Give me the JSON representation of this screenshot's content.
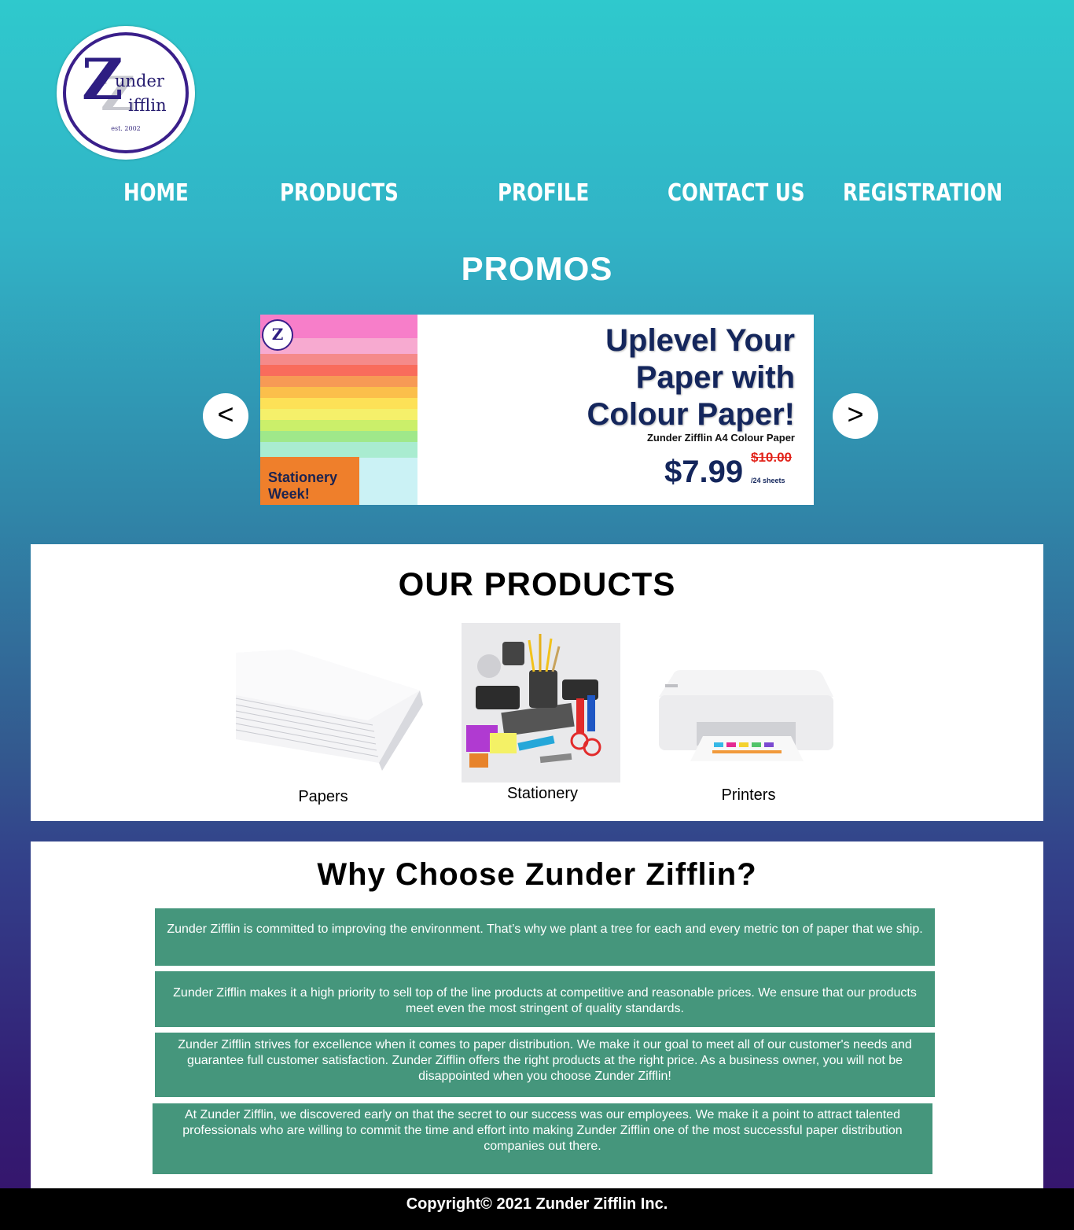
{
  "logo": {
    "initial_1": "Z",
    "initial_2": "Z",
    "word_1": "under",
    "word_2": "ifflin",
    "est": "est. 2002"
  },
  "nav": {
    "home": "Home",
    "products": "Products",
    "profile": "Profile",
    "contact": "Contact Us",
    "registration": "Registration"
  },
  "promos": {
    "title": "PROMOS",
    "prev": "<",
    "next": ">",
    "banner": {
      "tag_line1": "Stationery",
      "tag_line2": "Week!",
      "mini_logo": "Z",
      "headline_1": "Uplevel Your",
      "headline_2": "Paper with",
      "headline_3": "Colour Paper!",
      "subline": "Zunder Zifflin A4 Colour Paper",
      "old_price": "$10.00",
      "new_price": "$7.99",
      "unit": "/24 sheets"
    }
  },
  "products": {
    "title": "OUR PRODUCTS",
    "items": [
      {
        "label": "Papers"
      },
      {
        "label": "Stationery"
      },
      {
        "label": "Printers"
      }
    ]
  },
  "why": {
    "title": "Why Choose Zunder Zifflin?",
    "reasons": [
      "Zunder Zifflin is committed to improving the environment. That’s why we plant a tree for each and every metric ton of paper that we ship.",
      "Zunder Zifflin makes it a high priority to sell top of the line products at competitive and reasonable prices. We ensure that our products meet even the most stringent of quality standards.",
      "Zunder Zifflin strives for excellence when it comes to paper distribution. We make it our goal to meet all of our customer's needs and guarantee full customer satisfaction. Zunder Zifflin offers the right products at the right price. As a business owner, you will not be disappointed when you choose Zunder Zifflin!",
      "At Zunder Zifflin, we discovered early on that the secret to our success was our employees. We make it a point to attract talented professionals who are willing to commit the time and effort into making Zunder Zifflin one of the most successful paper distribution companies out there."
    ]
  },
  "footer": {
    "copyright": "Copyright© 2021 Zunder Zifflin Inc."
  },
  "colors": {
    "reason_bg": "#45967c",
    "brand_navy": "#14265c",
    "promo_orange": "#ef7f2b",
    "price_red": "#e2231a"
  }
}
